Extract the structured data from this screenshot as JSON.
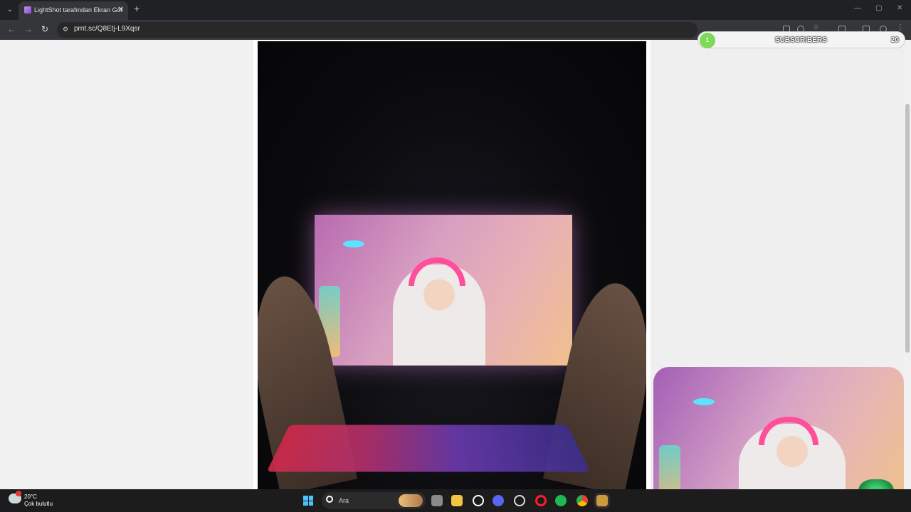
{
  "browser": {
    "tab_title": "LightShot tarafından Ekran Gör",
    "tab_close": "✕",
    "new_tab": "+",
    "url": "prnt.sc/Q8Etj-L9Xqsr",
    "nav": {
      "back": "←",
      "forward": "→",
      "reload": "↻"
    },
    "window_controls": {
      "minimize": "—",
      "maximize": "▢",
      "close": "✕"
    }
  },
  "overlay": {
    "subscribers_label": "SUBSCRIBERS",
    "subscribers_count": "20",
    "subscribers_current": "1",
    "progress_fraction": 0.05
  },
  "taskbar": {
    "temperature": "20°C",
    "weather": "Çok bulutlu",
    "search_placeholder": "Ara",
    "apps": [
      "task-view",
      "file-explorer",
      "steam",
      "discord",
      "obs",
      "opera",
      "spotify",
      "chrome",
      "league-client"
    ]
  },
  "colors": {
    "accent_green": "#7ed957",
    "windows_blue": "#4cc2ff",
    "headphone_pink": "#ff4f9a"
  }
}
